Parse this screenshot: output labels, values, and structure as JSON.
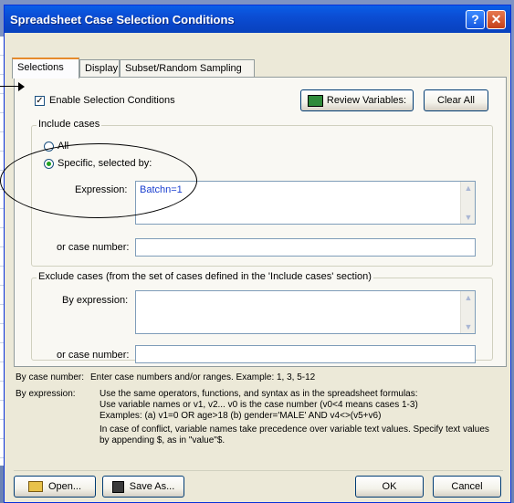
{
  "window": {
    "title": "Spreadsheet Case Selection Conditions",
    "help_glyph": "?",
    "close_glyph": "✕"
  },
  "tabs": [
    {
      "label": "Selections",
      "active": true
    },
    {
      "label": "Display",
      "active": false
    },
    {
      "label": "Subset/Random Sampling",
      "active": false
    }
  ],
  "enable": {
    "label": "Enable Selection Conditions",
    "checked": true
  },
  "buttons": {
    "review": "Review Variables:",
    "clear_all": "Clear All",
    "open": "Open...",
    "save_as": "Save As...",
    "ok": "OK",
    "cancel": "Cancel"
  },
  "include": {
    "group_label": "Include cases",
    "option_all": "All",
    "option_specific": "Specific, selected by:",
    "expression_label": "Expression:",
    "expression_value": "Batchn=1",
    "case_number_label": "or case number:",
    "case_number_value": ""
  },
  "exclude": {
    "group_label": "Exclude cases (from the set of cases defined in the 'Include cases' section)",
    "by_expression_label": "By expression:",
    "expression_value": "",
    "case_number_label": "or case number:",
    "case_number_value": ""
  },
  "help": {
    "by_case_key": "By case number:",
    "by_case_text": "Enter case numbers and/or ranges.  Example:  1, 3, 5-12",
    "by_expr_key": "By expression:",
    "by_expr_line1": "Use the same operators, functions, and syntax as in the spreadsheet formulas:",
    "by_expr_line2": "Use variable names or v1, v2...   v0 is the case number  (v0<4 means cases 1-3)",
    "by_expr_line3": "Examples:  (a) v1=0 OR age>18  (b) gender='MALE' AND v4<>(v5+v6)",
    "conflict_text": "In case of conflict, variable names take precedence over variable text values. Specify text values by appending $, as in \"value\"$."
  },
  "colors": {
    "title_bar": "#0a5fe8",
    "expression_text": "#1a3fd0",
    "radio_dot": "#21a121"
  }
}
